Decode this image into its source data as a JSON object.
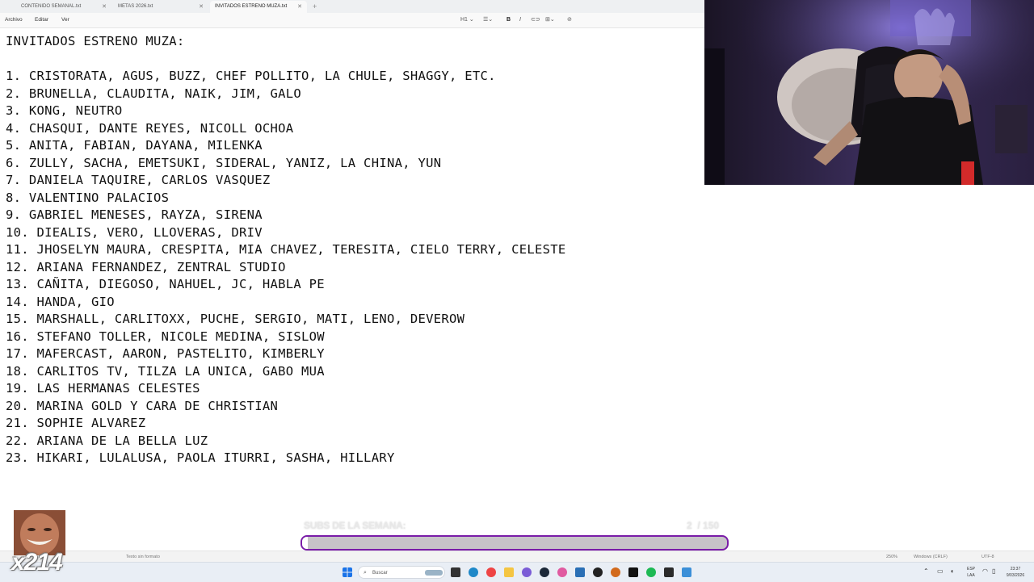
{
  "tabs": [
    {
      "label": "CONTENIDO SEMANAL.txt",
      "active": false
    },
    {
      "label": "METAS 2026.txt",
      "active": false
    },
    {
      "label": "INVITADOS ESTRENO MUZA.txt",
      "active": true
    }
  ],
  "menu": [
    "Archivo",
    "Editar",
    "Ver"
  ],
  "format_toolbar": {
    "heading": "H1",
    "bold": "B",
    "italic": "I"
  },
  "document": {
    "heading": "INVITADOS ESTRENO MUZA:",
    "lines": [
      "1. CRISTORATA, AGUS, BUZZ, CHEF POLLITO, LA CHULE, SHAGGY, ETC.",
      "2. BRUNELLA, CLAUDITA, NAIK, JIM, GALO",
      "3. KONG, NEUTRO",
      "4. CHASQUI, DANTE REYES, NICOLL OCHOA",
      "5. ANITA, FABIAN, DAYANA, MILENKA",
      "6. ZULLY, SACHA, EMETSUKI, SIDERAL, YANIZ, LA CHINA, YUN",
      "7. DANIELA TAQUIRE, CARLOS VASQUEZ",
      "8. VALENTINO PALACIOS",
      "9. GABRIEL MENESES, RAYZA, SIRENA",
      "10. DIEALIS, VERO, LLOVERAS, DRIV",
      "11. JHOSELYN MAURA, CRESPITA, MIA CHAVEZ, TERESITA, CIELO TERRY, CELESTE",
      "12. ARIANA FERNANDEZ, ZENTRAL STUDIO",
      "13. CAÑITA, DIEGOSO, NAHUEL, JC, HABLA PE",
      "14. HANDA, GIO",
      "15. MARSHALL, CARLITOXX, PUCHE, SERGIO, MATI, LENO, DEVEROW",
      "16. STEFANO TOLLER, NICOLE MEDINA, SISLOW",
      "17. MAFERCAST, AARON, PASTELITO, KIMBERLY",
      "18. CARLITOS TV, TILZA LA UNICA, GABO MUA",
      "19. LAS HERMANAS CELESTES",
      "20. MARINA GOLD Y CARA DE CHRISTIAN",
      "21. SOPHIE ALVAREZ",
      "22. ARIANA DE LA BELLA LUZ",
      "23. HIKARI, LULALUSA, PAOLA ITURRI, SASHA, HILLARY"
    ]
  },
  "statusbar": {
    "format": "Texto sin formato",
    "zoom": "250%",
    "line_ending": "Windows (CRLF)",
    "encoding": "UTF-8"
  },
  "subs_goal": {
    "label": "SUBS DE LA SEMANA:",
    "current": "2",
    "goal": "/ 150",
    "progress": 0.013,
    "bar_color": "#7a1ca8"
  },
  "emote": {
    "multiplier": "x214"
  },
  "taskbar": {
    "search_placeholder": "Buscar",
    "lang": "ESP",
    "lang_region": "LAA",
    "time": "23:37",
    "date": "9/03/2026"
  }
}
